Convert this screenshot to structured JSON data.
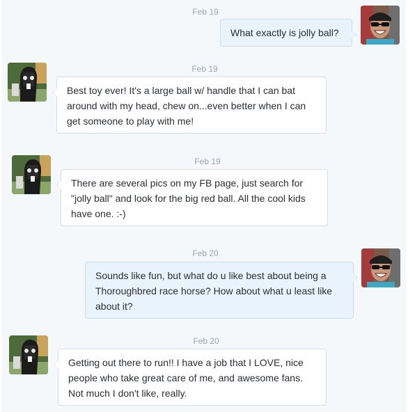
{
  "messages": [
    {
      "date": "Feb 19",
      "sender": "user",
      "text": "What exactly is jolly ball?"
    },
    {
      "date": "Feb 19",
      "sender": "horse",
      "text": "Best toy ever! It's a large ball w/ handle that I can bat around with my head, chew on...even better when I can get someone to play with me!"
    },
    {
      "date": "Feb 19",
      "sender": "horse",
      "text": "There are several pics on my FB page, just search for \"jolly ball\" and look for the big red ball. All the cool kids have one. :-)"
    },
    {
      "date": "Feb 20",
      "sender": "user",
      "text": "Sounds like fun, but what do u like best about being a Thoroughbred race horse? How about what u least like about it?"
    },
    {
      "date": "Feb 20",
      "sender": "horse",
      "text": "Getting out there to run!! I have a job that I LOVE, nice people who take great care of me, and awesome fans. Not much I don't like, really."
    }
  ],
  "avatars": {
    "user": "person-with-sunglasses-avatar",
    "horse": "racehorse-avatar"
  },
  "colors": {
    "background": "#f5f8fa",
    "incoming_bubble": "#ffffff",
    "outgoing_bubble": "#e8f3fb",
    "date_text": "#9aa7b2",
    "message_text": "#292f33"
  }
}
